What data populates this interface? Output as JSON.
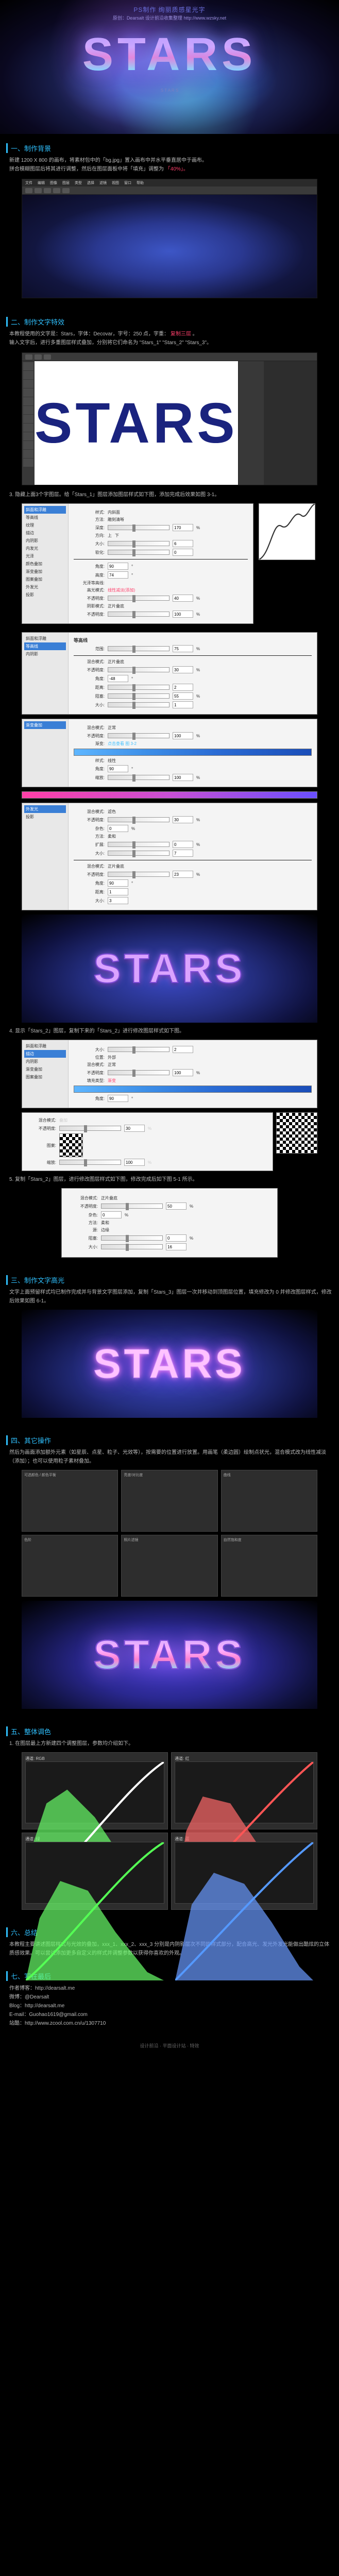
{
  "domain": "Document",
  "hero": {
    "topline": "PS制作 绚丽质感星光字",
    "subline": "原创：Dearsalt 设计前沿收集整理 http://www.wzsky.net",
    "title": "STARS",
    "desc": "S T A R S"
  },
  "sections": {
    "s1": {
      "num": "一、",
      "title": "制作背景"
    },
    "s2": {
      "num": "二、",
      "title": "制作文字特效"
    },
    "s3": {
      "num": "三、",
      "title": "制作文字高光"
    },
    "s4": {
      "num": "四、",
      "title": "其它操作"
    },
    "s5": {
      "num": "五、",
      "title": "整体调色"
    },
    "s6": {
      "num": "六、",
      "title": "总结"
    },
    "s7": {
      "num": "七、",
      "title": "写在最后"
    }
  },
  "body": {
    "s1_p1a": "新建 1200 X 800 的画布，将素材包中的「bg.jpg」置入画布中并水平垂直居中于画布。",
    "s1_p1b": "拼合模糊图层后将其进行调整，然后在图层面板中将「填充」调整为",
    "s1_p1c": "「40%」。",
    "s2_p1a": "本教程使用的文字是：Stars，字体：Decovar，字号：250 点，字重：",
    "s2_p1b": "复制三层",
    "s2_p1c": "。",
    "s2_p1d": "输入文字后，进行多重图层样式叠加，分别将它们命名为 \"Stars_1\" \"Stars_2\" \"Stars_3\"。",
    "s2_step3": "3. 隐藏上面3个字图层。给「Stars_1」图层添加图层样式如下图，添加完成后效果如图 3-1。",
    "s2_step4": "4. 显示「Stars_2」图层，复制下来的「Stars_2」进行修改图层样式如下图。",
    "s2_step5": "5. 复制「Stars_2」图层，进行修改图层样式如下图，修改完成后如下图 5-1 所示。",
    "s3_p1": "文字上面预留样式均已制作完成并与背景文字图层添加，复制「Stars_3」图层一次并移动到顶图层位置，填充修改为 0 并修改图层样式，修改后效果如图 6-1。",
    "s4_p1": "然后为画面添加额外元素（如星辰、点星、粒子、光效等），按需要的位置进行放置。用画笔（柔边圆）绘制点状光，混合模式改为线性减淡（添加）；也可以使用粒子素材叠加。",
    "s5_p1": "1. 在图层最上方新建四个调整图层，参数均介绍如下。",
    "s6_p1": "本教程主要讲述图层样式与光效的叠加，xxx_1、xxx_2、xxx_3 分别是内阴影层次不同的样式部分，配合高光、发光外发光能做出酷炫的立体质感效果。可以尝试添加更多自定义的样式并调整参数以获得你喜欢的外观。",
    "auth1": "作者博客：http://dearsalt.me",
    "auth2": "微博：@Dearsalt",
    "auth3": "Blog：http://dearsalt.me",
    "auth4": "E-mail：Guohao1619@gmail.com",
    "auth5": "站酷：http://www.zcool.com.cn/u/1307710",
    "footer": "设计前沿 · 平面设计站 · 特效"
  },
  "layerStyles": {
    "list": [
      "样式",
      "混合选项",
      "斜面和浮雕",
      "等高线",
      "纹理",
      "描边",
      "内阴影",
      "内发光",
      "光泽",
      "颜色叠加",
      "渐变叠加",
      "图案叠加",
      "外发光",
      "投影"
    ]
  },
  "bevel": {
    "style_l": "样式:",
    "style_v": "内斜面",
    "tech_l": "方法:",
    "tech_v": "雕刻清晰",
    "depth_l": "深度:",
    "depth_v": "170",
    "dir_l": "方向:",
    "dir_up": "上",
    "dir_dn": "下",
    "size_l": "大小:",
    "size_v": "6",
    "soft_l": "软化:",
    "soft_v": "0",
    "angle_l": "角度:",
    "angle_v": "90",
    "alt_l": "高度:",
    "alt_v": "74",
    "gloss_l": "光泽等高线:",
    "hmode_l": "高光模式:",
    "hmode_v": "线性减淡(添加)",
    "hopac_l": "不透明度:",
    "hopac_v": "40",
    "smode_l": "阴影模式:",
    "smode_v": "正片叠底",
    "sopac_l": "不透明度:",
    "sopac_v": "100",
    "contour_head": "等高线",
    "range_l": "范围:",
    "range_v": "75"
  },
  "innerShadow": {
    "mode_l": "混合模式:",
    "mode_v": "正片叠底",
    "opac_l": "不透明度:",
    "opac_v": "30",
    "angle_l": "角度:",
    "angle_v": "-48",
    "dist_l": "距离:",
    "dist_v": "2",
    "choke_l": "阻塞:",
    "choke_v": "55",
    "size_l": "大小:",
    "size_v": "1"
  },
  "gradOverlay": {
    "mode_l": "混合模式:",
    "mode_v": "正常",
    "opac_l": "不透明度:",
    "opac_v": "100",
    "grad_l": "渐变:",
    "style_l": "样式:",
    "style_v": "线性",
    "angle_l": "角度:",
    "angle_v": "90",
    "scale_l": "缩放:",
    "scale_v": "100",
    "note1": "点击查看 图 3-2",
    "note2": "点击查看 图 3-3"
  },
  "outerGlow": {
    "mode_l": "混合模式:",
    "mode_v": "滤色",
    "opac_l": "不透明度:",
    "opac_v": "30",
    "noise_l": "杂色:",
    "noise_v": "0",
    "tech_l": "方法:",
    "tech_v": "柔和",
    "spread_l": "扩展:",
    "spread_v": "0",
    "size_l": "大小:",
    "size_v": "7",
    "range_l": "范围:",
    "range_v": "50",
    "jitter_l": "抖动:",
    "jitter_v": "0"
  },
  "dropShadow": {
    "mode_l": "混合模式:",
    "mode_v": "正片叠底",
    "opac_l": "不透明度:",
    "opac_v": "23",
    "angle_l": "角度:",
    "angle_v": "90",
    "dist_l": "距离:",
    "dist_v": "1",
    "spread_l": "扩展:",
    "spread_v": "0",
    "size_l": "大小:",
    "size_v": "3"
  },
  "stroke": {
    "size_l": "大小:",
    "size_v": "2",
    "pos_l": "位置:",
    "pos_v": "外部",
    "mode_l": "混合模式:",
    "mode_v": "正常",
    "opac_l": "不透明度:",
    "opac_v": "100",
    "fill_l": "填充类型:",
    "fill_v": "渐变",
    "angle_l": "角度:",
    "angle_v": "90"
  },
  "pattern": {
    "mode_l": "混合模式:",
    "mode_v": "叠加",
    "opac_l": "不透明度:",
    "opac_v": "30",
    "pat_l": "图案:",
    "scale_l": "缩放:",
    "scale_v": "100"
  },
  "innerGlow": {
    "mode_l": "混合模式:",
    "mode_v": "正片叠底",
    "opac_l": "不透明度:",
    "opac_v": "50",
    "noise_l": "杂色:",
    "noise_v": "0",
    "tech_l": "方法:",
    "tech_v": "柔和",
    "src_l": "源:",
    "src_v": "边缘",
    "choke_l": "阻塞:",
    "choke_v": "0",
    "size_l": "大小:",
    "size_v": "16"
  },
  "curves": {
    "rgb": "RGB",
    "r": "红",
    "g": "绿",
    "b": "蓝",
    "label": "通道:"
  },
  "panels": {
    "p1": "可选颜色 / 颜色平衡",
    "p2": "亮度/对比度",
    "p3": "曲线",
    "p4": "色阶",
    "p5": "照片滤镜",
    "p6": "自然饱和度"
  },
  "starsText": "STARS",
  "psMenu": [
    "文件",
    "编辑",
    "图像",
    "图层",
    "类型",
    "选择",
    "滤镜",
    "视图",
    "窗口",
    "帮助"
  ]
}
